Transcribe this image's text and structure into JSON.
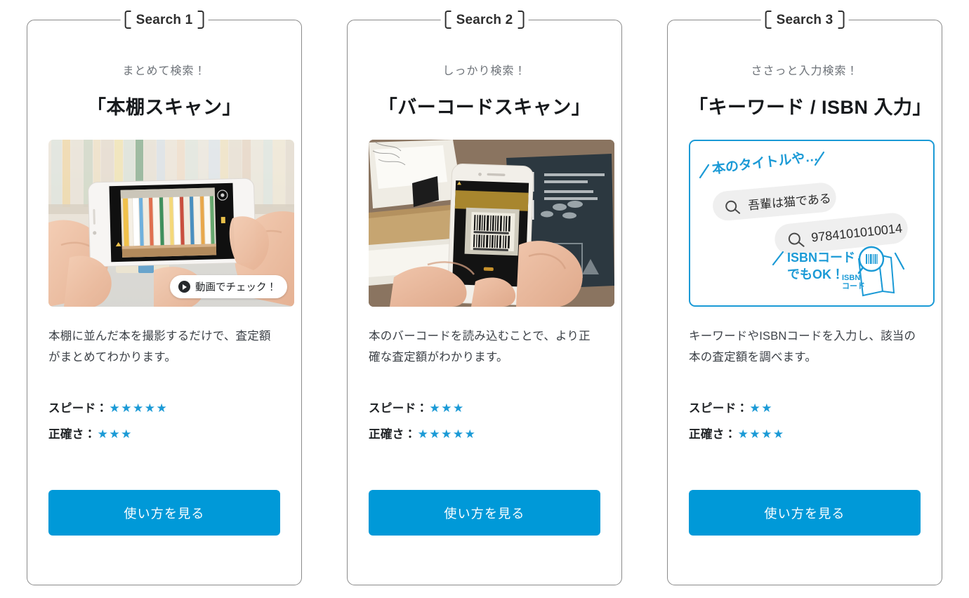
{
  "accent_blue": "#0099d8",
  "star_blue": "#1b9ad6",
  "card_border": "#8a8a8a",
  "cards": [
    {
      "badge": "Search 1",
      "eyebrow": "まとめて検索！",
      "title": "「本棚スキャン」",
      "media_type": "photo-bookshelf-scan",
      "video_badge": "動画でチェック！",
      "description": "本棚に並んだ本を撮影するだけで、査定額がまとめてわかります。",
      "ratings": [
        {
          "label": "スピード：",
          "stars": "★★★★★",
          "value": 5
        },
        {
          "label": "正確さ：",
          "stars": "★★★",
          "value": 3
        }
      ],
      "cta": "使い方を見る"
    },
    {
      "badge": "Search 2",
      "eyebrow": "しっかり検索！",
      "title": "「バーコードスキャン」",
      "media_type": "photo-barcode-scan",
      "video_badge": "",
      "description": "本のバーコードを読み込むことで、より正確な査定額がわかります。",
      "ratings": [
        {
          "label": "スピード：",
          "stars": "★★★",
          "value": 3
        },
        {
          "label": "正確さ：",
          "stars": "★★★★★",
          "value": 5
        }
      ],
      "cta": "使い方を見る"
    },
    {
      "badge": "Search 3",
      "eyebrow": "ささっと入力検索！",
      "title": "「キーワード / ISBN 入力」",
      "media_type": "illustration-keyword-isbn",
      "video_badge": "",
      "description": "キーワードやISBNコードを入力し、該当の本の査定額を調べます。",
      "ratings": [
        {
          "label": "スピード：",
          "stars": "★★",
          "value": 2
        },
        {
          "label": "正確さ：",
          "stars": "★★★★",
          "value": 4
        }
      ],
      "cta": "使い方を見る",
      "illustration": {
        "note_top": "本のタイトルや…",
        "pill_keyword": "吾輩は猫である",
        "pill_isbn": "9784101010014",
        "note_bottom_line1": "ISBNコード",
        "note_bottom_line2": "でもOK！",
        "book_icon_label_line1": "ISBN",
        "book_icon_label_line2": "コード"
      }
    }
  ]
}
